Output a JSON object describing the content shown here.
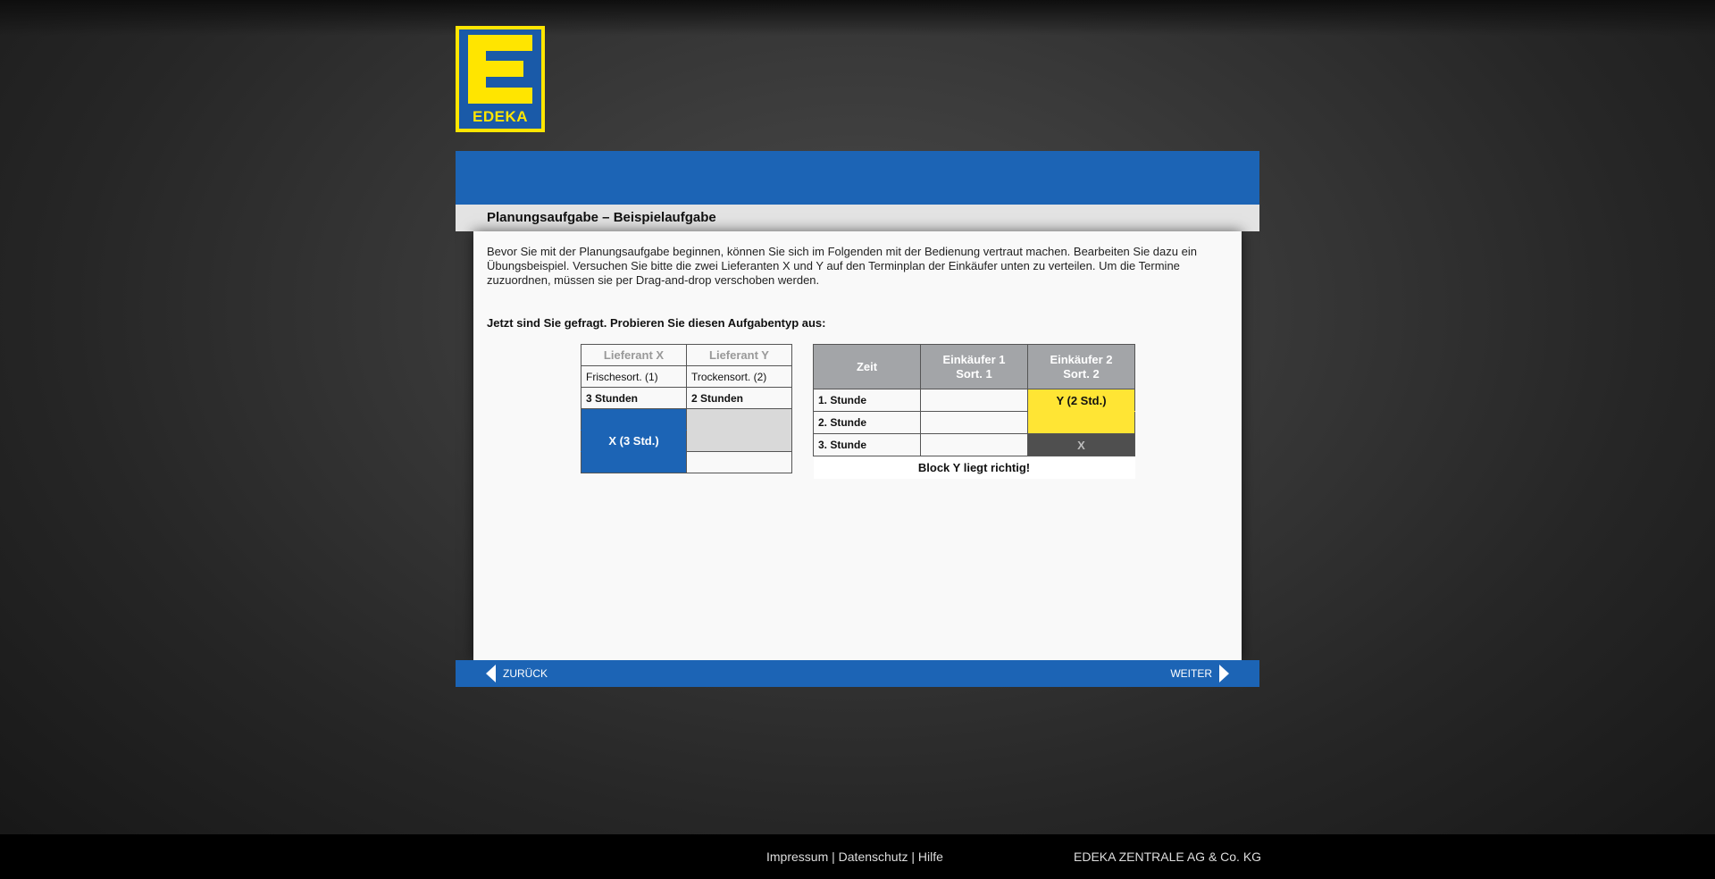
{
  "logo": {
    "text": "EDEKA"
  },
  "header": {
    "title": "Planungsaufgabe – Beispielaufgabe"
  },
  "content": {
    "intro": "Bevor Sie mit der Planungsaufgabe beginnen, können Sie sich im Folgenden mit der Bedienung vertraut machen. Bearbeiten Sie dazu ein Übungsbeispiel. Versuchen Sie bitte die zwei Lieferanten X und Y auf den Terminplan der Einkäufer unten zu verteilen. Um die Termine zuzuordnen, müssen sie per Drag-and-drop verschoben werden.",
    "prompt": "Jetzt sind Sie gefragt. Probieren Sie diesen Aufgabentyp aus:"
  },
  "suppliers": {
    "x": {
      "name": "Lieferant X",
      "sort": "Frischesort. (1)",
      "hours": "3 Stunden",
      "block": "X (3 Std.)"
    },
    "y": {
      "name": "Lieferant Y",
      "sort": "Trockensort. (2)",
      "hours": "2 Stunden"
    }
  },
  "schedule": {
    "col_time": "Zeit",
    "buyer1": {
      "line1": "Einkäufer 1",
      "line2": "Sort. 1"
    },
    "buyer2": {
      "line1": "Einkäufer 2",
      "line2": "Sort. 2"
    },
    "rows": [
      "1. Stunde",
      "2. Stunde",
      "3. Stunde"
    ],
    "y_block": "Y (2 Std.)",
    "blocked_mark": "X",
    "status": "Block Y liegt richtig!"
  },
  "nav": {
    "back_label": "ZURÜCK",
    "next_label": "WEITER"
  },
  "footer": {
    "impressum": "Impressum",
    "datenschutz": "Datenschutz",
    "hilfe": "Hilfe",
    "separator": "|",
    "company": "EDEKA ZENTRALE AG & Co. KG"
  },
  "colors": {
    "blue": "#1c64b5",
    "yellow": "#ffe534",
    "logo_yellow": "#ffe500"
  }
}
